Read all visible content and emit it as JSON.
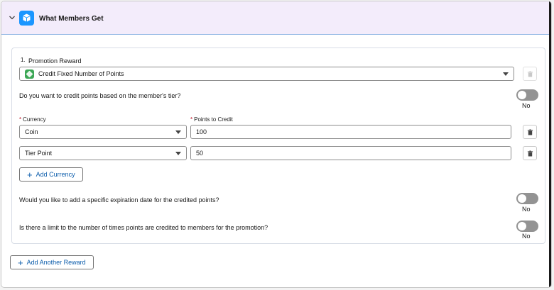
{
  "header": {
    "title": "What Members Get",
    "expand_icon": "chevron-down-icon",
    "section_icon": "gift-box-icon",
    "icon_color": "#1b96ff"
  },
  "reward": {
    "index": "1.",
    "label": "Promotion Reward",
    "selected": "Credit Fixed Number of Points",
    "selected_icon": "diamond-icon",
    "selected_icon_color": "#3ba755"
  },
  "tier_question": {
    "text": "Do you want to credit points based on the member's tier?",
    "toggle_state": "No"
  },
  "currency_section": {
    "currency_label": "Currency",
    "points_label": "Points to Credit",
    "required_marker": "*",
    "rows": [
      {
        "currency": "Coin",
        "points": "100"
      },
      {
        "currency": "Tier Point",
        "points": "50"
      }
    ],
    "add_button": "Add Currency"
  },
  "expiration_question": {
    "text": "Would you like to add a specific expiration date for the credited points?",
    "toggle_state": "No"
  },
  "limit_question": {
    "text": "Is there a limit to the number of times points are credited to members for the promotion?",
    "toggle_state": "No"
  },
  "add_reward_button": "Add Another Reward",
  "colors": {
    "header_bg": "#f3ecfb",
    "link_blue": "#0b5cab",
    "required_red": "#ba0517",
    "toggle_off": "#939393"
  }
}
